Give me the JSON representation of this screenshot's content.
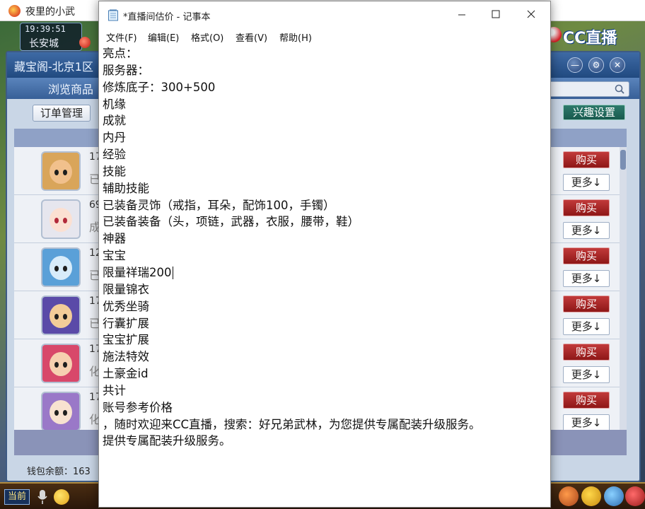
{
  "game": {
    "window_title": "夜里的小武",
    "time": "19:39:51",
    "location": "长安城",
    "cc_brand": "CC直播",
    "shop": {
      "title": "藏宝阁-北京1区",
      "nav_browse": "浏览商品",
      "order_button": "订单管理",
      "interest_button": "兴趣设置",
      "wallet_label": "钱包余额：163",
      "rows": [
        {
          "num": "17",
          "sub": "已",
          "buy": "购买",
          "more": "更多↓"
        },
        {
          "num": "69",
          "sub": "成",
          "buy": "购买",
          "more": "更多↓"
        },
        {
          "num": "12",
          "sub": "已",
          "buy": "购买",
          "more": "更多↓"
        },
        {
          "num": "17",
          "sub": "已",
          "buy": "购买",
          "more": "更多↓"
        },
        {
          "num": "17",
          "sub": "化",
          "buy": "购买",
          "more": "更多↓"
        },
        {
          "num": "17",
          "sub": "化",
          "buy": "购买",
          "more": "更多↓"
        }
      ]
    },
    "taskbar": {
      "current": "当前"
    }
  },
  "notepad": {
    "title": "*直播间估价 - 记事本",
    "menu": {
      "file": "文件(F)",
      "edit": "编辑(E)",
      "format": "格式(O)",
      "view": "查看(V)",
      "help": "帮助(H)"
    },
    "lines": [
      "亮点：",
      "服务器：",
      "修炼底子：300+500",
      "机缘",
      "成就",
      "内丹",
      "经验",
      "技能",
      "辅助技能",
      "已装备灵饰（戒指，耳朵，配饰100，手镯）",
      "已装备装备（头，项链，武器，衣服，腰带，鞋）",
      "神器",
      "宝宝",
      "限量祥瑞200",
      "限量锦衣",
      "优秀坐骑",
      "行囊扩展",
      "宝宝扩展",
      "施法特效",
      "土豪金id",
      "共计",
      "账号参考价格",
      "，随时欢迎来CC直播，搜索：好兄弟武林，为您提供专属配装升级服务。",
      "提供专属配装升级服务。"
    ]
  },
  "colors": {
    "buy_button": "#a52626",
    "interest_button": "#21695c",
    "shop_header": "#2d578e"
  }
}
